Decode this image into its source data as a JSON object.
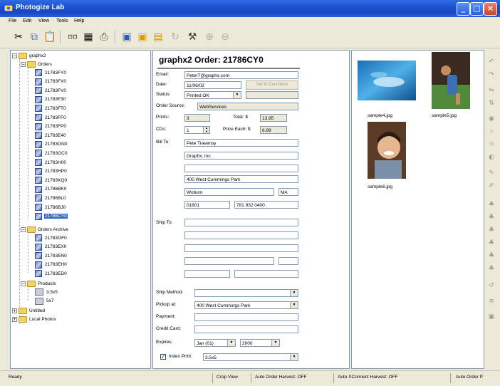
{
  "window": {
    "title": "Photogize Lab"
  },
  "menu": [
    "File",
    "Edit",
    "View",
    "Tools",
    "Help"
  ],
  "tree": {
    "root": "graphx2",
    "orders_label": "Orders",
    "orders": [
      "21783FY0",
      "21783FX0",
      "21783FV0",
      "21783F30",
      "21783FT0",
      "21783FF0",
      "21783FP0",
      "21783E40",
      "21783GN0",
      "21783GC0",
      "21783H00",
      "21783HP0",
      "21783KQ0",
      "21786BK0",
      "21786BL0",
      "21786BJ0",
      "21786CY0"
    ],
    "archive_label": "Orders Archive",
    "archive": [
      "21783GF0",
      "21783EX0",
      "21783EN0",
      "21783EH0",
      "21783ED0"
    ],
    "products_label": "Products",
    "products": [
      "3.5x5",
      "5x7"
    ],
    "other": [
      "Untitled",
      "Local Photos"
    ]
  },
  "order": {
    "heading": "graphx2 Order: 21786CY0",
    "email_label": "Email:",
    "email": "PeterT@graphx.com",
    "date_label": "Date:",
    "date": "11/06/02",
    "set_button": "Set to Dunchbox",
    "status_label": "Status:",
    "status": "Printed OK",
    "source_label": "Order Source:",
    "source": "WebServices",
    "prints_label": "Prints:",
    "prints": "3",
    "total_label": "Total: $",
    "total": "13.95",
    "cds_label": "CDs:",
    "cds": "1",
    "price_label": "Price Each: $",
    "price": "6.99",
    "billto_label": "Bill To:",
    "bill": {
      "name": "Pete Travensy",
      "company": "Graphx, Inc.",
      "street": "400 West Cummings Park",
      "city": "Woburn",
      "state": "MA",
      "zip": "01801",
      "phone": "781 932 0400"
    },
    "shipto_label": "Ship To:",
    "ship_method_label": "Ship Method:",
    "pickup_label": "Pickup at:",
    "pickup": "400 West Cummings Park",
    "payment_label": "Payment:",
    "credit_label": "Credit Card:",
    "expires_label": "Expires:",
    "exp_month": "Jan (01)",
    "exp_year": "2000",
    "index_print_label": "Index Print:",
    "index_print": "3.5x5"
  },
  "thumbnails": [
    {
      "file": "sample4.jpg"
    },
    {
      "file": "sample5.jpg"
    },
    {
      "file": "sample6.jpg"
    }
  ],
  "statusbar": {
    "left": "Ready",
    "crop": "Crop View",
    "harvest": "Auto Order Harvest: OFF",
    "xconnect": "Auto XConnect Harvest: OFF",
    "right": "Auto Order P"
  }
}
